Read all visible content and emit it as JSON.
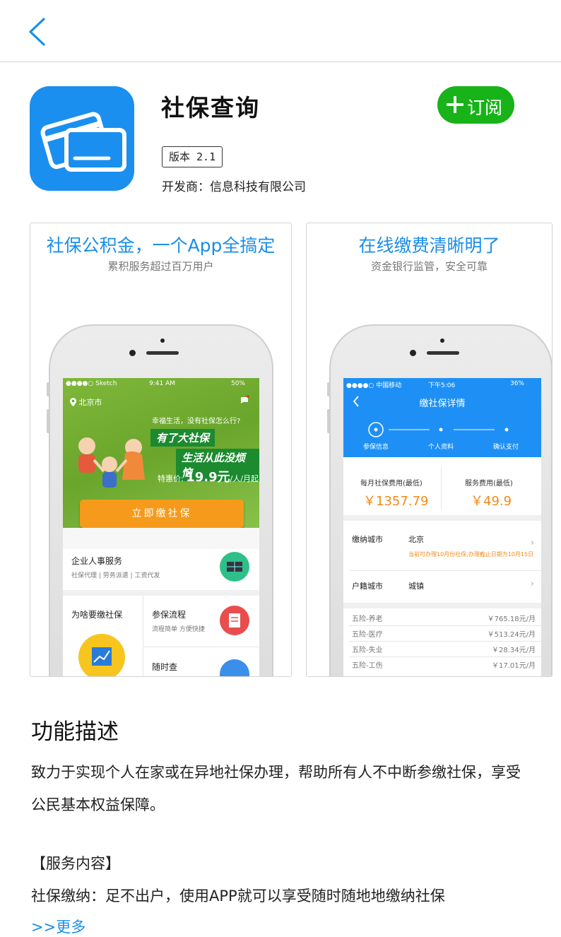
{
  "app": {
    "name": "社保查询",
    "version": "版本 2.1",
    "developer": "开发商：信息科技有限公司",
    "subscribe_label": "订阅"
  },
  "colors": {
    "accent_blue": "#1a8ee8",
    "icon_blue": "#1a8ff0",
    "subscribe_green": "#17b318",
    "cta_orange": "#f59a1a",
    "price_orange": "#f28a1a"
  },
  "icons": [
    "back-chevron-icon",
    "credit-card-icon",
    "plus-icon",
    "location-pin-icon",
    "message-icon"
  ],
  "screenshots": [
    {
      "title": "社保公积金，一个App全搞定",
      "subtitle": "累积服务超过百万用户",
      "status": {
        "carrier": "●●●●○ Sketch",
        "time": "9:41 AM",
        "battery": "50%"
      },
      "location": "北京市",
      "hero_question": "幸福生活，没有社保怎么行?",
      "banner1": "有了大社保",
      "banner2": "生活从此没烦恼",
      "price_prefix": "特惠价:",
      "price_value": "19.9元",
      "price_suffix": "/人/月起",
      "cta": "立即缴社保",
      "service_title": "企业人事服务",
      "service_sub": "社保代理 | 劳务派遣 | 工资代发",
      "why_title": "为啥要缴社保",
      "process_title": "参保流程",
      "process_sub": "流程简单 方便快捷",
      "query_title": "随时查"
    },
    {
      "title": "在线缴费清晰明了",
      "subtitle": "资金银行监管，安全可靠",
      "status": {
        "carrier": "●●●●○ 中国移动",
        "time": "下午5:06",
        "battery": "36%"
      },
      "header_title": "缴社保详情",
      "steps": [
        "参保信息",
        "个人资料",
        "确认支付"
      ],
      "monthly_label": "每月社保费用(最低)",
      "monthly_value": "￥1357.79",
      "service_label": "服务费用(最低)",
      "service_value": "￥49.9",
      "city_label": "缴纳城市",
      "city_value": "北京",
      "city_note": "当前可办理10月份社保,办理截止日期为10月15日",
      "hukou_label": "户籍城市",
      "hukou_value": "城镇",
      "items": [
        {
          "name": "五险-养老",
          "amount": "￥765.18元/月"
        },
        {
          "name": "五险-医疗",
          "amount": "￥513.24元/月"
        },
        {
          "name": "五险-失业",
          "amount": "￥28.34元/月"
        },
        {
          "name": "五险-工伤",
          "amount": "￥17.01元/月"
        }
      ]
    }
  ],
  "description": {
    "title": "功能描述",
    "text": "致力于实现个人在家或在异地社保办理，帮助所有人不中断参缴社保，享受公民基本权益保障。",
    "service_heading": "【服务内容】",
    "service_text": "社保缴纳：足不出户，使用APP就可以享受随时随地地缴纳社保",
    "more": ">>更多"
  }
}
